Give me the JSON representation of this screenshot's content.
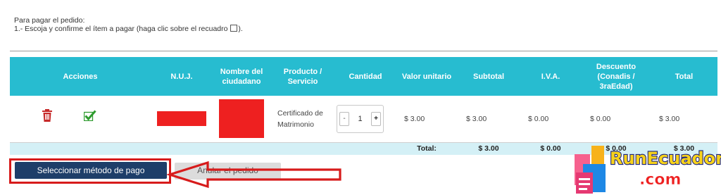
{
  "instructions": {
    "line1": "Para pagar el pedido:",
    "line2_before": "1.- Escoja y confirme el ítem a pagar (haga clic sobre el recuadro ",
    "line2_after": ")."
  },
  "table": {
    "headers": {
      "acciones": "Acciones",
      "nuj": "N.U.J.",
      "nombre": "Nombre del ciudadano",
      "producto": "Producto / Servicio",
      "cantidad": "Cantidad",
      "valor_unitario": "Valor unitario",
      "subtotal": "Subtotal",
      "iva": "I.V.A.",
      "descuento": "Descuento (Conadis / 3raEdad)",
      "total": "Total"
    },
    "row": {
      "producto": "Certificado de Matrimonio",
      "cantidad": "1",
      "valor_unitario": "$ 3.00",
      "subtotal": "$ 3.00",
      "iva": "$ 0.00",
      "descuento": "$ 0.00",
      "total": "$ 3.00"
    },
    "totals": {
      "label": "Total:",
      "subtotal": "$ 3.00",
      "iva": "$ 0.00",
      "descuento": "$ 0.00",
      "total": "$ 3.00"
    }
  },
  "buttons": {
    "select_payment": "Seleccionar método de pago",
    "cancel_order": "Anular el pedido"
  },
  "stepper": {
    "minus": "-",
    "plus": "+"
  },
  "logo": {
    "text": "RunEcuador .com"
  },
  "colors": {
    "header_bg": "#27bcd0",
    "total_row_bg": "#d4f0f6",
    "primary_button": "#1e3e69",
    "highlight_red": "#d71b1b",
    "trash_red": "#c62828",
    "check_green": "#2e9b2e"
  },
  "icons": [
    "trash-icon",
    "checkbox-checked-icon",
    "arrow-left-icon"
  ]
}
